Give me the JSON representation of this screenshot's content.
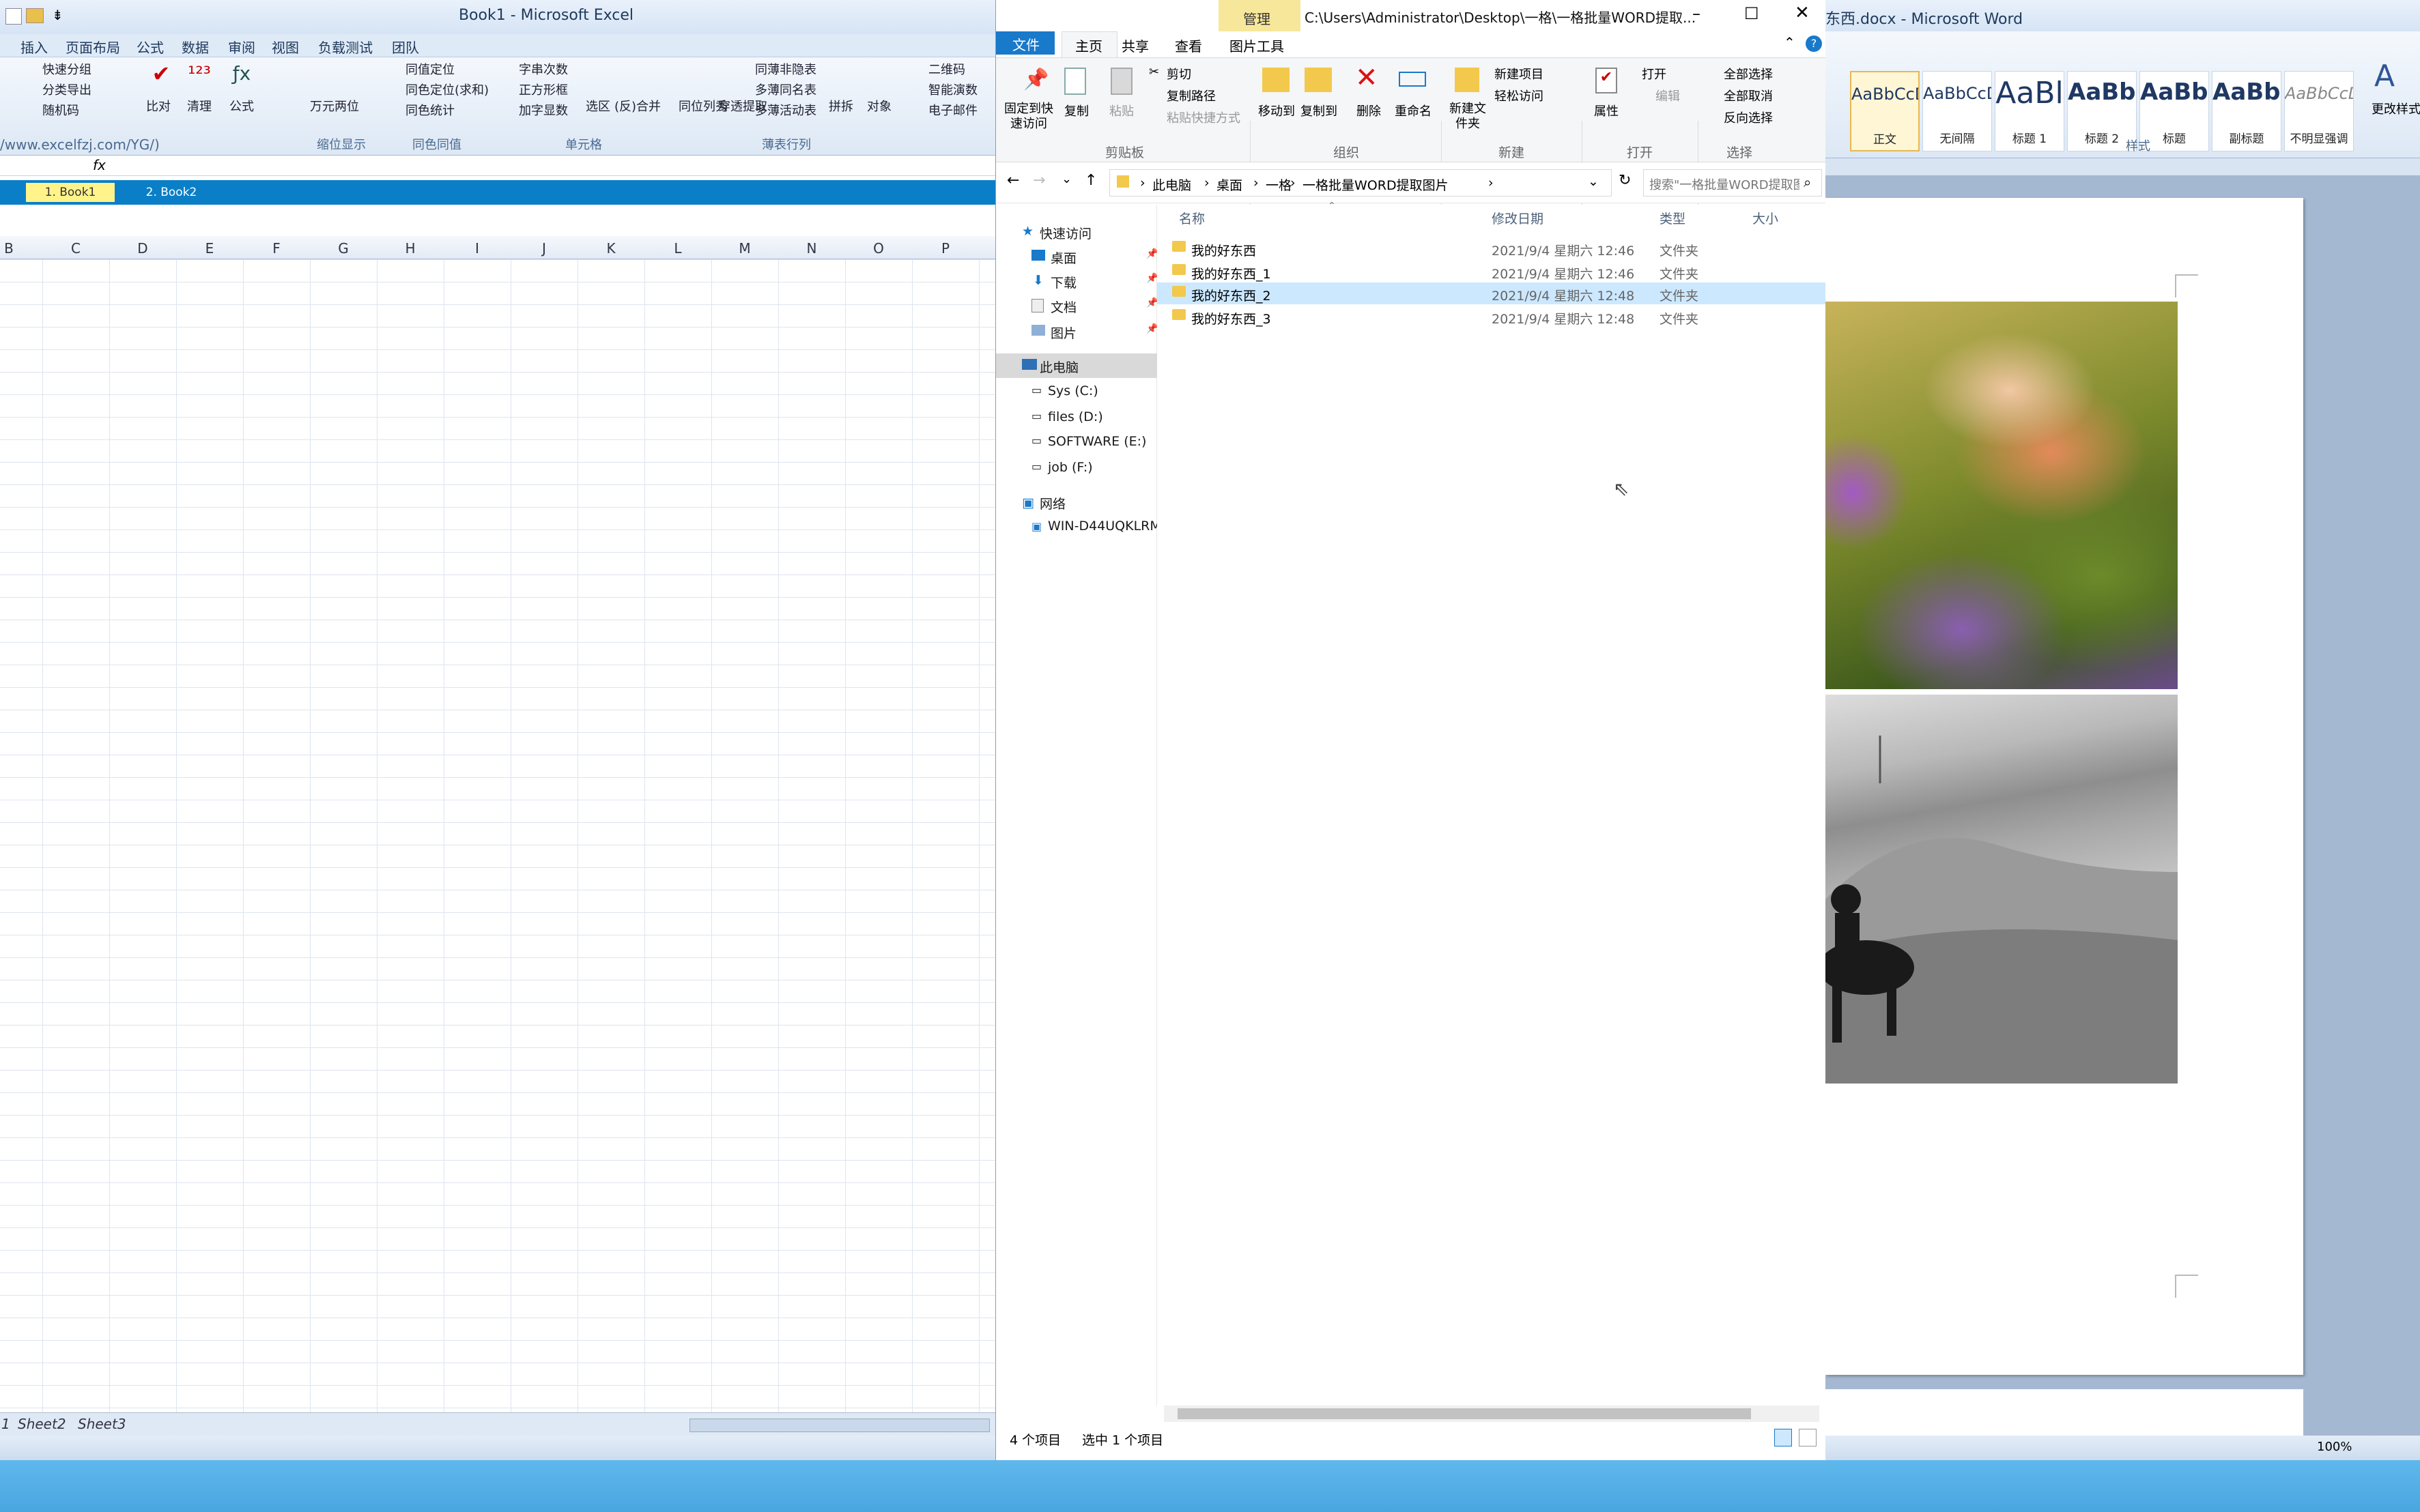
{
  "excel": {
    "title": "Book1 - Microsoft Excel",
    "menu": [
      "插入",
      "页面布局",
      "公式",
      "数据",
      "审阅",
      "视图",
      "负载测试",
      "团队"
    ],
    "ribbon_items": [
      "快速分组",
      "分类导出",
      "随机码",
      "比对",
      "清理",
      "公式",
      "万元两位",
      "同值定位",
      "同色定位(求和)",
      "同色统计",
      "字串次数",
      "正方形框",
      "加字显数",
      "选区",
      "(反)合并",
      "同位列秀",
      "穿透提取",
      "同薄非隐表",
      "多薄同名表",
      "多薄活动表",
      "拼拆",
      "对象",
      "二维码",
      "智能演数",
      "电子邮件"
    ],
    "groups": [
      "缩位显示",
      "同色同值",
      "单元格",
      "薄表行列"
    ],
    "url": "/www.excelfzj.com/YG/)",
    "formula_fx": "fx",
    "workbook_tabs": [
      "1. Book1",
      "2. Book2"
    ],
    "columns": [
      "B",
      "C",
      "D",
      "E",
      "F",
      "G",
      "H",
      "I",
      "J",
      "K",
      "L",
      "M",
      "N",
      "O",
      "P"
    ],
    "sheets": [
      "1",
      "Sheet2",
      "Sheet3"
    ]
  },
  "explorer": {
    "title": "C:\\Users\\Administrator\\Desktop\\一格\\一格批量WORD提取...",
    "manage_tab": "管理",
    "tabs": [
      "文件",
      "主页",
      "共享",
      "查看",
      "图片工具"
    ],
    "ribbon": {
      "pin": "固定到快速访问",
      "copy": "复制",
      "paste": "粘贴",
      "cut": "剪切",
      "copy_path": "复制路径",
      "paste_shortcut": "粘贴快捷方式",
      "move_to": "移动到",
      "copy_to": "复制到",
      "delete": "删除",
      "rename": "重命名",
      "new_folder": "新建文件夹",
      "new_item": "新建项目",
      "easy_access": "轻松访问",
      "properties": "属性",
      "open": "打开",
      "edit": "编辑",
      "select_all": "全部选择",
      "select_none": "全部取消",
      "invert": "反向选择"
    },
    "groups": [
      "剪贴板",
      "组织",
      "新建",
      "打开",
      "选择"
    ],
    "breadcrumb": [
      "此电脑",
      "桌面",
      "一格",
      "一格批量WORD提取图片"
    ],
    "search_placeholder": "搜索\"一格批量WORD提取图片\"",
    "nav": {
      "quick_access": "快速访问",
      "quick_items": [
        "桌面",
        "下载",
        "文档",
        "图片"
      ],
      "this_pc": "此电脑",
      "drives": [
        "Sys (C:)",
        "files (D:)",
        "SOFTWARE (E:)",
        "job (F:)"
      ],
      "network": "网络",
      "network_items": [
        "WIN-D44UQKLRM"
      ]
    },
    "columns": {
      "name": "名称",
      "date": "修改日期",
      "type": "类型",
      "size": "大小"
    },
    "rows": [
      {
        "name": "我的好东西",
        "date": "2021/9/4 星期六 12:46",
        "type": "文件夹"
      },
      {
        "name": "我的好东西_1",
        "date": "2021/9/4 星期六 12:46",
        "type": "文件夹"
      },
      {
        "name": "我的好东西_2",
        "date": "2021/9/4 星期六 12:48",
        "type": "文件夹"
      },
      {
        "name": "我的好东西_3",
        "date": "2021/9/4 星期六 12:48",
        "type": "文件夹"
      }
    ],
    "selected_row": 2,
    "status": {
      "count": "4 个项目",
      "selected": "选中 1 个项目"
    }
  },
  "word": {
    "title": "东西.docx - Microsoft Word",
    "styles": [
      {
        "sample": "AaBbCcDc",
        "name": "正文"
      },
      {
        "sample": "AaBbCcDc",
        "name": "无间隔"
      },
      {
        "sample": "AaBl",
        "name": "标题 1"
      },
      {
        "sample": "AaBbC",
        "name": "标题 2"
      },
      {
        "sample": "AaBbC",
        "name": "标题"
      },
      {
        "sample": "AaBbC",
        "name": "副标题"
      },
      {
        "sample": "AaBbCcDc",
        "name": "不明显强调"
      }
    ],
    "change_styles": "更改样式",
    "group": "样式",
    "zoom": "100%"
  },
  "colors": {
    "excel_tab_bar": "#0a7fc8",
    "explorer_selection": "#cce8ff",
    "folder": "#f2c94c",
    "taskbar": "#5ab3e8"
  }
}
